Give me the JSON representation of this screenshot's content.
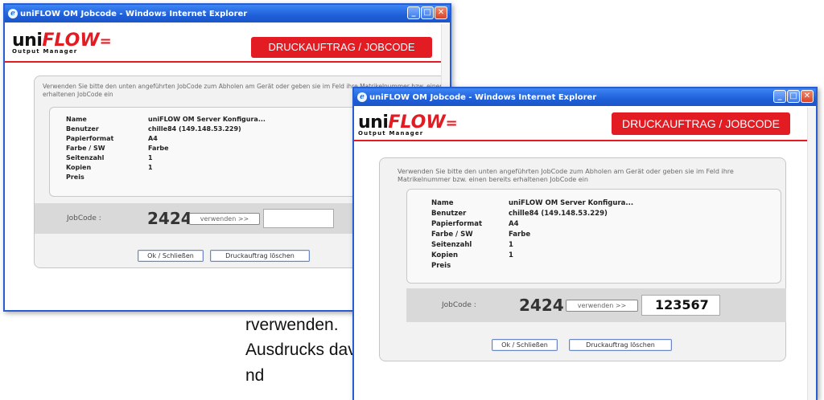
{
  "background": {
    "line1": "rverwenden.",
    "line2": "Ausdrucks davor",
    "line3": "nd",
    "dot": "."
  },
  "window_back": {
    "title": "uniFLOW OM Jobcode - Windows Internet Explorer",
    "logo_text": "uni",
    "logo_flow": "FLOW",
    "logo_sub": "Output Manager",
    "banner": "DRUCKAUFTRAG / JOBCODE",
    "instruction": "Verwenden Sie bitte den unten angeführten JobCode zum Abholen am Gerät oder geben sie im Feld ihre Matrikelnummer bzw. einen bereits erhaltenen JobCode ein",
    "rows": [
      {
        "label": "Name",
        "value": "uniFLOW OM Server Konfigura..."
      },
      {
        "label": "Benutzer",
        "value": "chille84 (149.148.53.229)"
      },
      {
        "label": "Papierformat",
        "value": "A4"
      },
      {
        "label": "Farbe / SW",
        "value": "Farbe"
      },
      {
        "label": "Seitenzahl",
        "value": "1"
      },
      {
        "label": "Kopien",
        "value": "1"
      },
      {
        "label": "Preis",
        "value": ""
      }
    ],
    "jobcode_label": "JobCode :",
    "jobcode_value": "2424",
    "use_button": "verwenden >>",
    "input_value": "",
    "ok_button": "Ok / Schließen",
    "delete_button": "Druckauftrag löschen"
  },
  "window_front": {
    "title": "uniFLOW OM Jobcode - Windows Internet Explorer",
    "logo_text": "uni",
    "logo_flow": "FLOW",
    "logo_sub": "Output Manager",
    "banner": "DRUCKAUFTRAG / JOBCODE",
    "instruction": "Verwenden Sie bitte den unten angeführten JobCode zum Abholen am Gerät oder geben sie im Feld ihre Matrikelnummer bzw. einen bereits erhaltenen JobCode ein",
    "rows": [
      {
        "label": "Name",
        "value": "uniFLOW OM Server Konfigura..."
      },
      {
        "label": "Benutzer",
        "value": "chille84 (149.148.53.229)"
      },
      {
        "label": "Papierformat",
        "value": "A4"
      },
      {
        "label": "Farbe / SW",
        "value": "Farbe"
      },
      {
        "label": "Seitenzahl",
        "value": "1"
      },
      {
        "label": "Kopien",
        "value": "1"
      },
      {
        "label": "Preis",
        "value": ""
      }
    ],
    "jobcode_label": "JobCode :",
    "jobcode_value": "2424",
    "use_button": "verwenden >>",
    "input_value": "123567",
    "ok_button": "Ok / Schließen",
    "delete_button": "Druckauftrag löschen"
  },
  "colors": {
    "titlebar": "#1f5fd8",
    "accent_red": "#e31b23",
    "panel_bg": "#f2f2f2",
    "jobcode_bg": "#d9d9d9"
  },
  "icons": {
    "window_icon": "internet-explorer-icon",
    "minimize": "minimize-icon",
    "maximize": "maximize-icon",
    "close": "close-icon"
  }
}
